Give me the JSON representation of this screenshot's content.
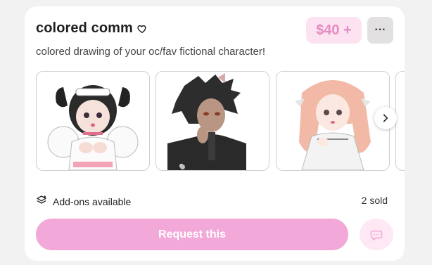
{
  "listing": {
    "title": "colored comm",
    "price": "$40 +",
    "description": "colored drawing of your oc/fav fictional character!",
    "more_label": "···",
    "addons_label": "Add-ons available",
    "sold_label": "2 sold",
    "request_label": "Request this"
  },
  "colors": {
    "accent": "#f2a9da",
    "price_bg": "#fde2f1",
    "price_text": "#e58bc2"
  },
  "icons": [
    "heart-icon",
    "more-icon",
    "chevron-right-icon",
    "addons-layers-icon",
    "chat-icon"
  ],
  "carousel": {
    "images": [
      "maid-girl-artwork",
      "dark-haired-boy-artwork",
      "pink-haired-girl-artwork",
      "partial-artwork"
    ]
  }
}
